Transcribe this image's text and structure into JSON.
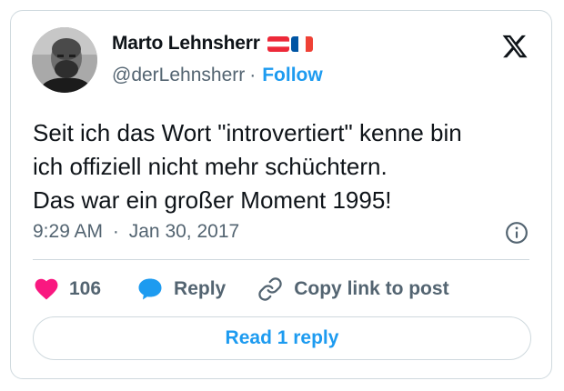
{
  "author": {
    "display_name": "Marto Lehnsherr",
    "handle": "@derLehnsherr",
    "separator": "·",
    "follow_label": "Follow",
    "flags": [
      "austria-flag",
      "france-flag"
    ]
  },
  "tweet": {
    "lines": [
      "Seit ich das Wort \"introvertiert\" kenne bin",
      "ich offiziell nicht mehr schüchtern.",
      "Das war ein großer Moment 1995!"
    ],
    "time": "9:29 AM",
    "separator": "·",
    "date": "Jan 30, 2017"
  },
  "actions": {
    "like_count": "106",
    "reply_label": "Reply",
    "copy_label": "Copy link to post"
  },
  "footer": {
    "read_replies_label": "Read 1 reply"
  },
  "icons": {
    "logo": "x-logo-icon",
    "info": "info-icon",
    "like": "heart-icon",
    "reply": "speech-bubble-icon",
    "copy": "link-icon"
  },
  "colors": {
    "accent": "#1d9bf0",
    "like": "#f91880",
    "secondary_text": "#536471",
    "border": "#cfd9de",
    "text": "#0f1419"
  }
}
